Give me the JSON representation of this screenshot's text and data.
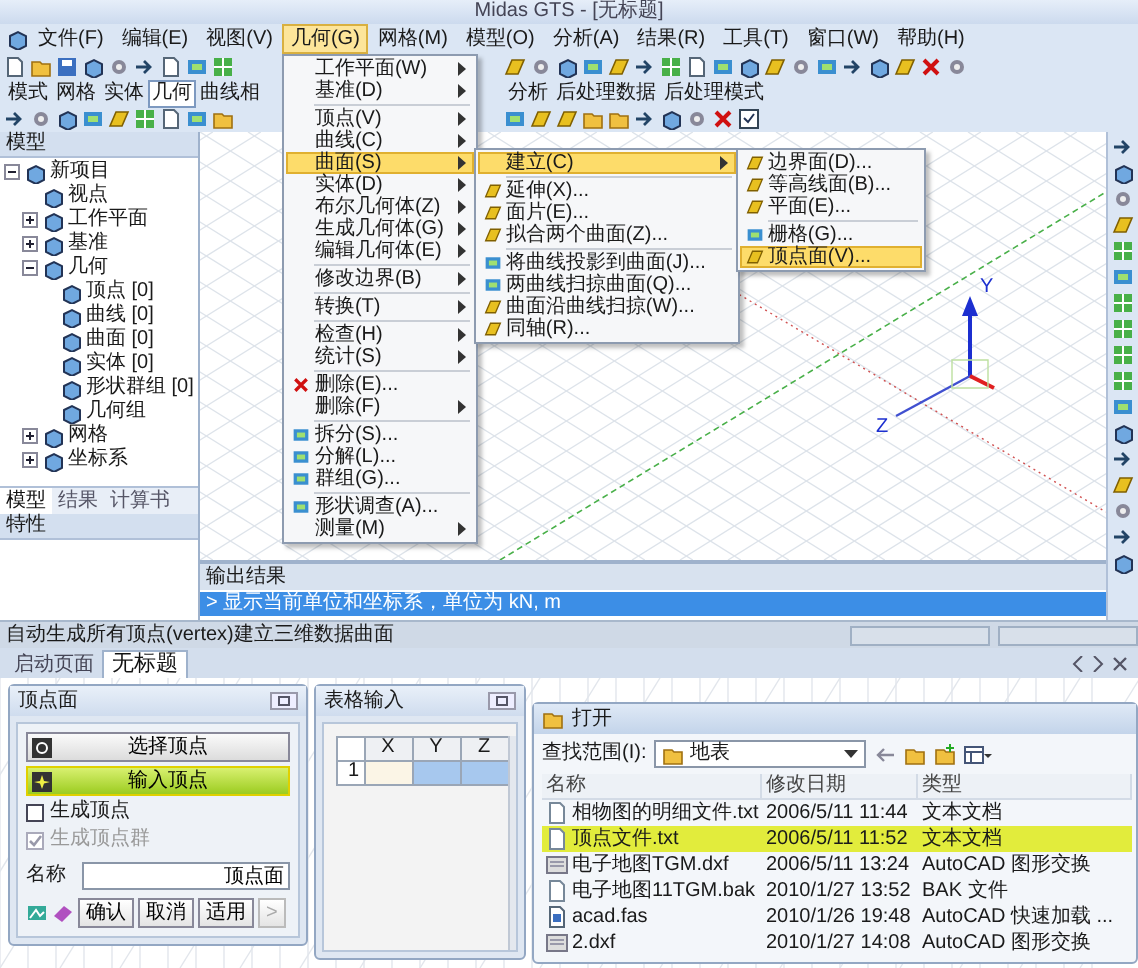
{
  "window": {
    "title": "Midas GTS - [无标题]"
  },
  "menu_bar": [
    {
      "label": "文件(F)",
      "selected": false
    },
    {
      "label": "编辑(E)",
      "selected": false
    },
    {
      "label": "视图(V)",
      "selected": false
    },
    {
      "label": "几何(G)",
      "selected": true
    },
    {
      "label": "网格(M)",
      "selected": false
    },
    {
      "label": "模型(O)",
      "selected": false
    },
    {
      "label": "分析(A)",
      "selected": false
    },
    {
      "label": "结果(R)",
      "selected": false
    },
    {
      "label": "工具(T)",
      "selected": false
    },
    {
      "label": "窗口(W)",
      "selected": false
    },
    {
      "label": "帮助(H)",
      "selected": false
    }
  ],
  "toolbar": {
    "tabs": [
      {
        "label": "模式",
        "selected": false
      },
      {
        "label": "网格",
        "selected": false
      },
      {
        "label": "实体",
        "selected": false
      },
      {
        "label": "几何",
        "selected": true
      },
      {
        "label": "曲线相",
        "selected": false
      }
    ],
    "tabs_right": [
      {
        "label": "分析",
        "selected": false
      },
      {
        "label": "后处理数据",
        "selected": false
      },
      {
        "label": "后处理模式",
        "selected": false
      }
    ]
  },
  "geometry_menu": [
    {
      "kind": "item",
      "label": "工作平面(W)",
      "submenu": true,
      "selected": false
    },
    {
      "kind": "item",
      "label": "基准(D)",
      "submenu": true,
      "selected": false
    },
    {
      "kind": "separator"
    },
    {
      "kind": "item",
      "label": "顶点(V)",
      "submenu": true,
      "selected": false
    },
    {
      "kind": "item",
      "label": "曲线(C)",
      "submenu": true,
      "selected": false
    },
    {
      "kind": "item",
      "label": "曲面(S)",
      "submenu": true,
      "selected": true,
      "children": [
        {
          "kind": "item",
          "label": "建立(C)",
          "submenu": true,
          "selected": true,
          "children": [
            {
              "kind": "surface_item",
              "label": "边界面(D)...",
              "submenu": false,
              "selected": false
            },
            {
              "kind": "surface_item",
              "label": "等高线面(B)...",
              "submenu": false,
              "selected": false
            },
            {
              "kind": "surface_item",
              "label": "平面(E)...",
              "submenu": false,
              "selected": false
            },
            {
              "kind": "separator"
            },
            {
              "kind": "tool_item",
              "label": "栅格(G)...",
              "submenu": false,
              "selected": false
            },
            {
              "kind": "surface_item",
              "label": "顶点面(V)...",
              "submenu": false,
              "selected": true
            }
          ]
        },
        {
          "kind": "separator"
        },
        {
          "kind": "surface_item",
          "label": "延伸(X)...",
          "submenu": false,
          "selected": false
        },
        {
          "kind": "surface_item",
          "label": "面片(E)...",
          "submenu": false,
          "selected": false
        },
        {
          "kind": "surface_item",
          "label": "拟合两个曲面(Z)...",
          "submenu": false,
          "selected": false
        },
        {
          "kind": "separator"
        },
        {
          "kind": "tool_item",
          "label": "将曲线投影到曲面(J)...",
          "submenu": false,
          "selected": false
        },
        {
          "kind": "tool_item",
          "label": "两曲线扫掠曲面(Q)...",
          "submenu": false,
          "selected": false
        },
        {
          "kind": "surface_item",
          "label": "曲面沿曲线扫掠(W)...",
          "submenu": false,
          "selected": false
        },
        {
          "kind": "surface_item",
          "label": "同轴(R)...",
          "submenu": false,
          "selected": false
        }
      ]
    },
    {
      "kind": "item",
      "label": "实体(D)",
      "submenu": true,
      "selected": false
    },
    {
      "kind": "item",
      "label": "布尔几何体(Z)",
      "submenu": true,
      "selected": false
    },
    {
      "kind": "item",
      "label": "生成几何体(G)",
      "submenu": true,
      "selected": false
    },
    {
      "kind": "item",
      "label": "编辑几何体(E)",
      "submenu": true,
      "selected": false
    },
    {
      "kind": "separator"
    },
    {
      "kind": "item",
      "label": "修改边界(B)",
      "submenu": true,
      "selected": false
    },
    {
      "kind": "separator"
    },
    {
      "kind": "item",
      "label": "转换(T)",
      "submenu": true,
      "selected": false
    },
    {
      "kind": "separator"
    },
    {
      "kind": "item",
      "label": "检查(H)",
      "submenu": true,
      "selected": false
    },
    {
      "kind": "item",
      "label": "统计(S)",
      "submenu": true,
      "selected": false
    },
    {
      "kind": "separator"
    },
    {
      "kind": "delete_item",
      "label": "删除(E)...",
      "submenu": false,
      "selected": false
    },
    {
      "kind": "item",
      "label": "删除(F)",
      "submenu": true,
      "selected": false
    },
    {
      "kind": "separator"
    },
    {
      "kind": "tool_item",
      "label": "拆分(S)...",
      "submenu": false,
      "selected": false
    },
    {
      "kind": "tool_item",
      "label": "分解(L)...",
      "submenu": false,
      "selected": false
    },
    {
      "kind": "tool_item",
      "label": "群组(G)...",
      "submenu": false,
      "selected": false
    },
    {
      "kind": "separator"
    },
    {
      "kind": "tool_item",
      "label": "形状调查(A)...",
      "submenu": false,
      "selected": false
    },
    {
      "kind": "item",
      "label": "测量(M)",
      "submenu": true,
      "selected": false
    }
  ],
  "left_panel": {
    "title": "模型",
    "tree": [
      {
        "label": "新项目",
        "expanded": true,
        "children": [
          {
            "label": "视点"
          },
          {
            "label": "工作平面",
            "expanded": false
          },
          {
            "label": "基准",
            "expanded": false
          },
          {
            "label": "几何",
            "expanded": true,
            "children": [
              {
                "label": "顶点 [0]"
              },
              {
                "label": "曲线 [0]"
              },
              {
                "label": "曲面 [0]"
              },
              {
                "label": "实体 [0]"
              },
              {
                "label": "形状群组 [0]"
              },
              {
                "label": "几何组"
              }
            ]
          },
          {
            "label": "网格",
            "expanded": false
          },
          {
            "label": "坐标系",
            "expanded": false
          }
        ]
      }
    ],
    "tabs": [
      {
        "label": "模型",
        "selected": true
      },
      {
        "label": "结果",
        "selected": false
      },
      {
        "label": "计算书",
        "selected": false
      }
    ],
    "properties_title": "特性"
  },
  "viewport": {
    "axis_labels": [
      "Y",
      "Z"
    ]
  },
  "output": {
    "title": "输出结果",
    "lines": [
      {
        "text": "> 显示当前单位和坐标系，单位为 kN, m",
        "selected": true
      }
    ]
  },
  "status_bar": {
    "text": "自动生成所有顶点(vertex)建立三维数据曲面"
  },
  "document_tabs": [
    {
      "label": "启动页面",
      "selected": false
    },
    {
      "label": "无标题",
      "selected": true
    }
  ],
  "vertex_dialog": {
    "title": "顶点面",
    "buttons": [
      {
        "label": "选择顶点",
        "selected": false
      },
      {
        "label": "输入顶点",
        "selected": true
      }
    ],
    "options": [
      {
        "label": "生成顶点",
        "checked": false,
        "disabled": false
      },
      {
        "label": "生成顶点群",
        "checked": true,
        "disabled": true
      }
    ],
    "name_label": "名称",
    "name_value": "顶点面",
    "actions": [
      {
        "label": "确认",
        "disabled": false
      },
      {
        "label": "取消",
        "disabled": false
      },
      {
        "label": "适用",
        "disabled": false
      },
      {
        "label": ">",
        "disabled": true
      }
    ]
  },
  "table_dialog": {
    "title": "表格输入",
    "columns": [
      "X",
      "Y",
      "Z"
    ],
    "rows": [
      {
        "index": "1",
        "cells": [
          {
            "selected": false
          },
          {
            "selected": true
          },
          {
            "selected": true
          }
        ]
      }
    ]
  },
  "open_dialog": {
    "title": "打开",
    "look_in_label": "查找范围(I):",
    "look_in_value": "地表",
    "columns": [
      "名称",
      "修改日期",
      "类型"
    ],
    "files": [
      {
        "name": "相物图的明细文件.txt",
        "date": "2006/5/11 11:44",
        "type": "文本文档",
        "kind": "text",
        "selected": false
      },
      {
        "name": "顶点文件.txt",
        "date": "2006/5/11 11:52",
        "type": "文本文档",
        "kind": "text",
        "selected": true
      },
      {
        "name": "电子地图TGM.dxf",
        "date": "2006/5/11 13:24",
        "type": "AutoCAD 图形交换",
        "kind": "drawing",
        "selected": false
      },
      {
        "name": "电子地图11TGM.bak",
        "date": "2010/1/27 13:52",
        "type": "BAK 文件",
        "kind": "text",
        "selected": false
      },
      {
        "name": "acad.fas",
        "date": "2010/1/26 19:48",
        "type": "AutoCAD 快速加载 ...",
        "kind": "script",
        "selected": false
      },
      {
        "name": "2.dxf",
        "date": "2010/1/27 14:08",
        "type": "AutoCAD 图形交换",
        "kind": "drawing",
        "selected": false
      }
    ]
  }
}
